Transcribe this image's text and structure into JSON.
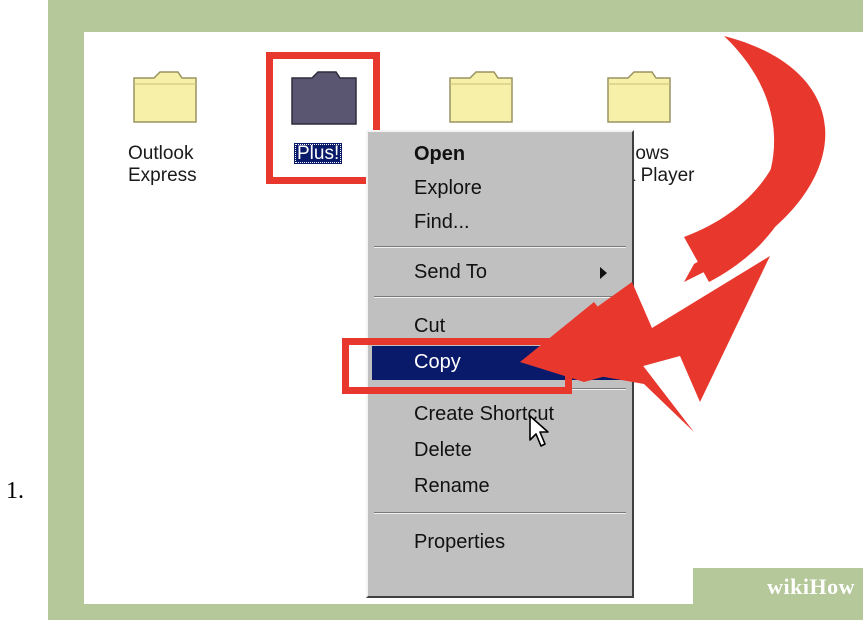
{
  "step_number": "1.",
  "desktop_icons": [
    {
      "label_line1": "Outlook",
      "label_line2": "Express"
    },
    {
      "label_line1": "Plus!",
      "label_line2": ""
    },
    {
      "label_line1": "",
      "label_line2": ""
    },
    {
      "label_line1": "indows",
      "label_line2": "dia Player"
    }
  ],
  "context_menu": {
    "items": [
      {
        "label": "Open"
      },
      {
        "label": "Explore"
      },
      {
        "label": "Find..."
      },
      {
        "label": "Send To"
      },
      {
        "label": "Cut"
      },
      {
        "label": "Copy"
      },
      {
        "label": "Create Shortcut"
      },
      {
        "label": "Delete"
      },
      {
        "label": "Rename"
      },
      {
        "label": "Properties"
      }
    ]
  },
  "watermark": {
    "part1": "wiki",
    "part2": "How"
  },
  "colors": {
    "highlight_red": "#e8382e",
    "selection_blue": "#0a1a6a",
    "menu_gray": "#c0c0c0",
    "frame_green": "#b5c89a",
    "folder_yellow": "#f6f0a8",
    "folder_dark": "#5a5570"
  },
  "icons": [
    "folder-icon",
    "submenu-arrow-icon",
    "mouse-cursor-icon",
    "curved-arrow-annotation"
  ]
}
